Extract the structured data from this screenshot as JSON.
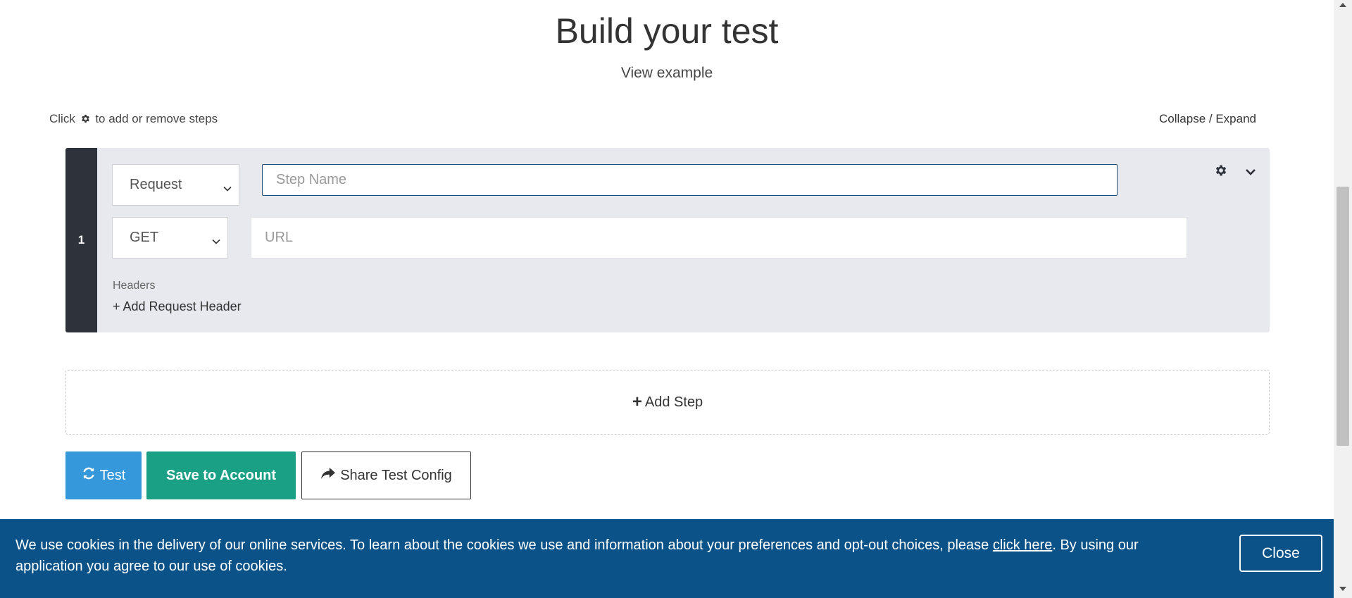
{
  "header": {
    "title": "Build your test",
    "view_example": "View example"
  },
  "hint": {
    "before": "Click",
    "after": "to add or remove steps",
    "icon": "gear-icon"
  },
  "collapse_expand": "Collapse / Expand",
  "step": {
    "number": "1",
    "type": "Request",
    "name_placeholder": "Step Name",
    "method": "GET",
    "url_placeholder": "URL",
    "headers_label": "Headers",
    "add_header": "+ Add Request Header",
    "icons": [
      "gear-icon",
      "chevron-down-icon"
    ]
  },
  "add_step": {
    "plus": "+",
    "label": "Add Step"
  },
  "buttons": {
    "test": "Test",
    "save": "Save to Account",
    "share": "Share Test Config"
  },
  "cookie_banner": {
    "text_before": "We use cookies in the delivery of our online services. To learn about the cookies we use and information about your preferences and opt-out choices, please ",
    "link": "click here",
    "text_after": ". By using our application you agree to our use of cookies.",
    "close": "Close"
  },
  "colors": {
    "test_button": "#3498db",
    "save_button": "#1aa085",
    "cookie_banner": "#0a5287",
    "step_sidebar": "#2d323b",
    "step_background": "#e8e9ee"
  }
}
